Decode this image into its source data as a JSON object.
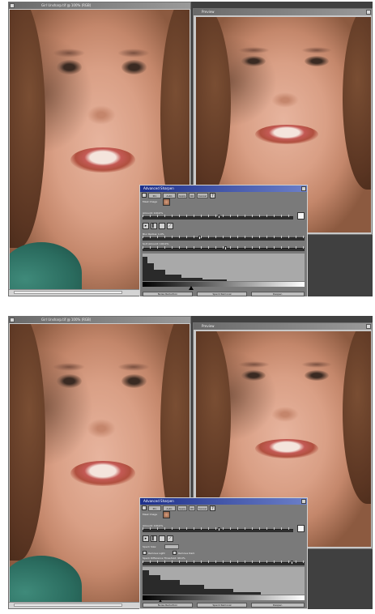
{
  "panels": [
    {
      "id": "top",
      "left_window": {
        "title": "Girl Unsharp.tif @ 100% (RGB)"
      },
      "right_window": {
        "title": "Preview"
      },
      "dialog": {
        "title": "Advanced Sharpen",
        "toolbar": [
          "Pro",
          "Auto",
          "Apply",
          "OK",
          "Cancel"
        ],
        "labels": [
          "Mask Image",
          "Amount: 100.0%",
          "Blur Radius: 1.0%",
          "Sort Amount: 100.0%"
        ],
        "buttons": [
          "Noise Reduction",
          "Speck Removal",
          "Despec."
        ]
      }
    },
    {
      "id": "bottom",
      "left_window": {
        "title": "Girl Unsharp.tif @ 100% (RGB)"
      },
      "right_window": {
        "title": "Preview"
      },
      "dialog": {
        "title": "Advanced Sharpen",
        "toolbar": [
          "Pro",
          "Auto",
          "Apply",
          "OK",
          "Cancel"
        ],
        "labels": [
          "Mask Image",
          "Amount: 100.0%",
          "Speck Size:",
          "Remove Light",
          "Remove Dark",
          "Speck Difference Threshold: 98.0%"
        ],
        "buttons": [
          "Noise Reduction",
          "Speck Removal",
          "Despec."
        ]
      }
    }
  ]
}
